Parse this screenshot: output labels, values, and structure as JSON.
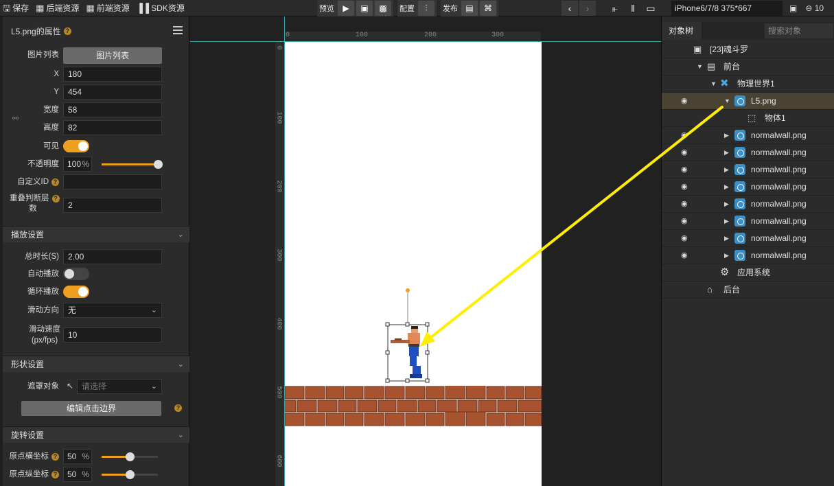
{
  "topbar": {
    "save": "保存",
    "backend_assets": "后端资源",
    "frontend_assets": "前端资源",
    "sdk_assets": "SDK资源",
    "preview": "预览",
    "config": "配置",
    "publish": "发布",
    "device": "iPhone6/7/8 375*667",
    "zoom_partial": "10"
  },
  "props": {
    "title": "L5.png的属性",
    "image_list_label": "图片列表",
    "image_list_button": "图片列表",
    "x_label": "X",
    "x_value": "180",
    "y_label": "Y",
    "y_value": "454",
    "width_label": "宽度",
    "width_value": "58",
    "height_label": "高度",
    "height_value": "82",
    "visible_label": "可见",
    "opacity_label": "不透明度",
    "opacity_value": "100",
    "opacity_unit": "%",
    "custom_id_label": "自定义ID",
    "custom_id_value": "",
    "overlap_label_1": "重叠判断层",
    "overlap_label_2": "数",
    "overlap_value": "2"
  },
  "playback": {
    "section": "播放设置",
    "duration_label": "总时长(S)",
    "duration_value": "2.00",
    "autoplay_label": "自动播放",
    "loop_label": "循环播放",
    "direction_label": "滑动方向",
    "direction_value": "无",
    "speed_label_1": "滑动速度",
    "speed_label_2": "(px/fps)",
    "speed_value": "10"
  },
  "shape": {
    "section": "形状设置",
    "mask_label": "遮罩对象",
    "mask_placeholder": "请选择",
    "edit_button": "编辑点击边界"
  },
  "rotation": {
    "section": "旋转设置",
    "origin_x_label": "原点横坐标",
    "origin_x_value": "50",
    "origin_x_unit": "%",
    "origin_y_label": "原点纵坐标",
    "origin_y_value": "50",
    "origin_y_unit": "%"
  },
  "ruler": {
    "top_ticks": [
      "0",
      "100",
      "200",
      "300"
    ],
    "left_ticks": [
      "0",
      "100",
      "200",
      "300",
      "400",
      "500",
      "600"
    ]
  },
  "tree": {
    "tab": "对象树",
    "search_placeholder": "搜索对象",
    "items": [
      {
        "label": "[23]魂斗罗"
      },
      {
        "label": "前台"
      },
      {
        "label": "物理世界1"
      },
      {
        "label": "L5.png"
      },
      {
        "label": "物体1"
      },
      {
        "label": "normalwall.png"
      },
      {
        "label": "normalwall.png"
      },
      {
        "label": "normalwall.png"
      },
      {
        "label": "normalwall.png"
      },
      {
        "label": "normalwall.png"
      },
      {
        "label": "normalwall.png"
      },
      {
        "label": "normalwall.png"
      },
      {
        "label": "normalwall.png"
      },
      {
        "label": "应用系统"
      },
      {
        "label": "后台"
      }
    ]
  },
  "colors": {
    "accent": "#f0a020",
    "annotation_arrow": "#ffee00",
    "guide": "#3cc4c4",
    "selection_row": "#4a4232"
  }
}
